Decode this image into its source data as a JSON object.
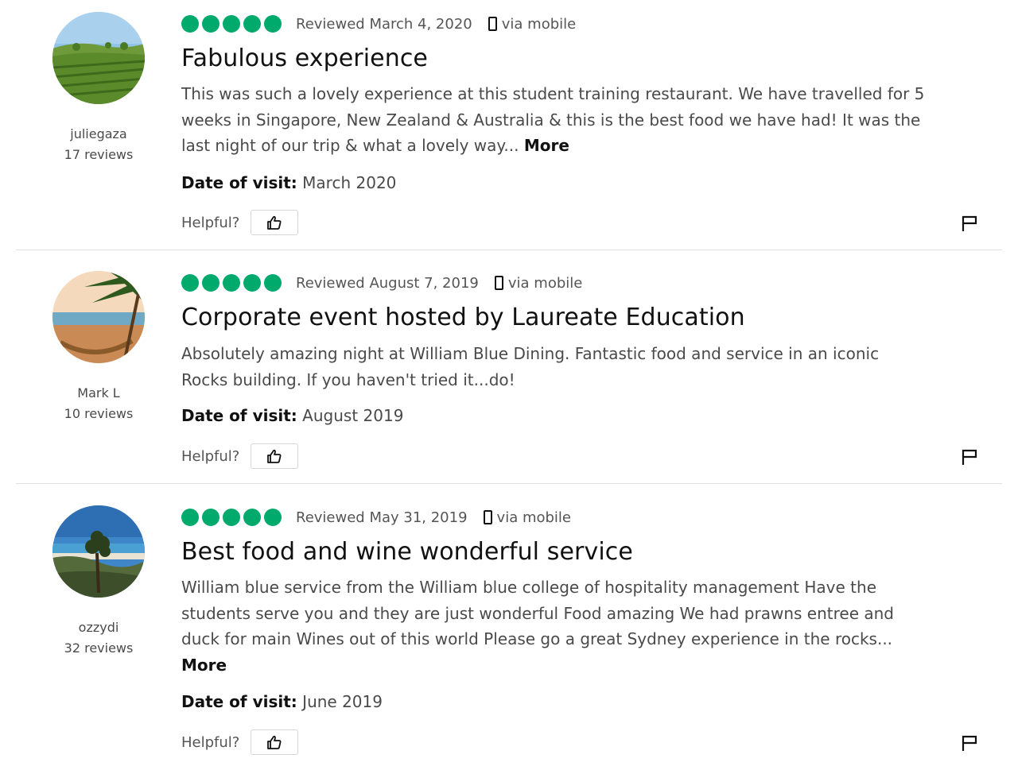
{
  "reviews": [
    {
      "user": {
        "name": "juliegaza",
        "review_count": "17 reviews",
        "avatar_icon": "vineyard-avatar"
      },
      "rating": 5,
      "reviewed_date": "Reviewed March 4, 2020",
      "via": "via mobile",
      "title": "Fabulous experience",
      "body": "This was such a lovely experience at this student training restaurant. We have travelled for 5 weeks in Singapore, New Zealand & Australia & this is the best food we have had! It was the last night of our trip & what a lovely way...",
      "more": "More",
      "visit_label": "Date of visit:",
      "visit_value": "March 2020",
      "helpful_label": "Helpful?"
    },
    {
      "user": {
        "name": "Mark L",
        "review_count": "10 reviews",
        "avatar_icon": "beach-hammock-avatar"
      },
      "rating": 5,
      "reviewed_date": "Reviewed August 7, 2019",
      "via": "via mobile",
      "title": "Corporate event hosted by Laureate Education",
      "body": "Absolutely amazing night at William Blue Dining. Fantastic food and service in an iconic Rocks building. If you haven't tried it...do!",
      "more": "",
      "visit_label": "Date of visit:",
      "visit_value": "August 2019",
      "helpful_label": "Helpful?"
    },
    {
      "user": {
        "name": "ozzydi",
        "review_count": "32 reviews",
        "avatar_icon": "coast-tree-avatar"
      },
      "rating": 5,
      "reviewed_date": "Reviewed May 31, 2019",
      "via": "via mobile",
      "title": "Best food and wine wonderful service",
      "body": "William blue service from the William blue college of hospitality management Have the students serve you and they are just wonderful Food amazing We had prawns entree and duck for main Wines out of this world Please go a great Sydney experience in the rocks...",
      "more": "More",
      "visit_label": "Date of visit:",
      "visit_value": "June 2019",
      "helpful_label": "Helpful?"
    }
  ],
  "colors": {
    "bubble": "#00aa6c",
    "divider": "#e0e0e0"
  }
}
